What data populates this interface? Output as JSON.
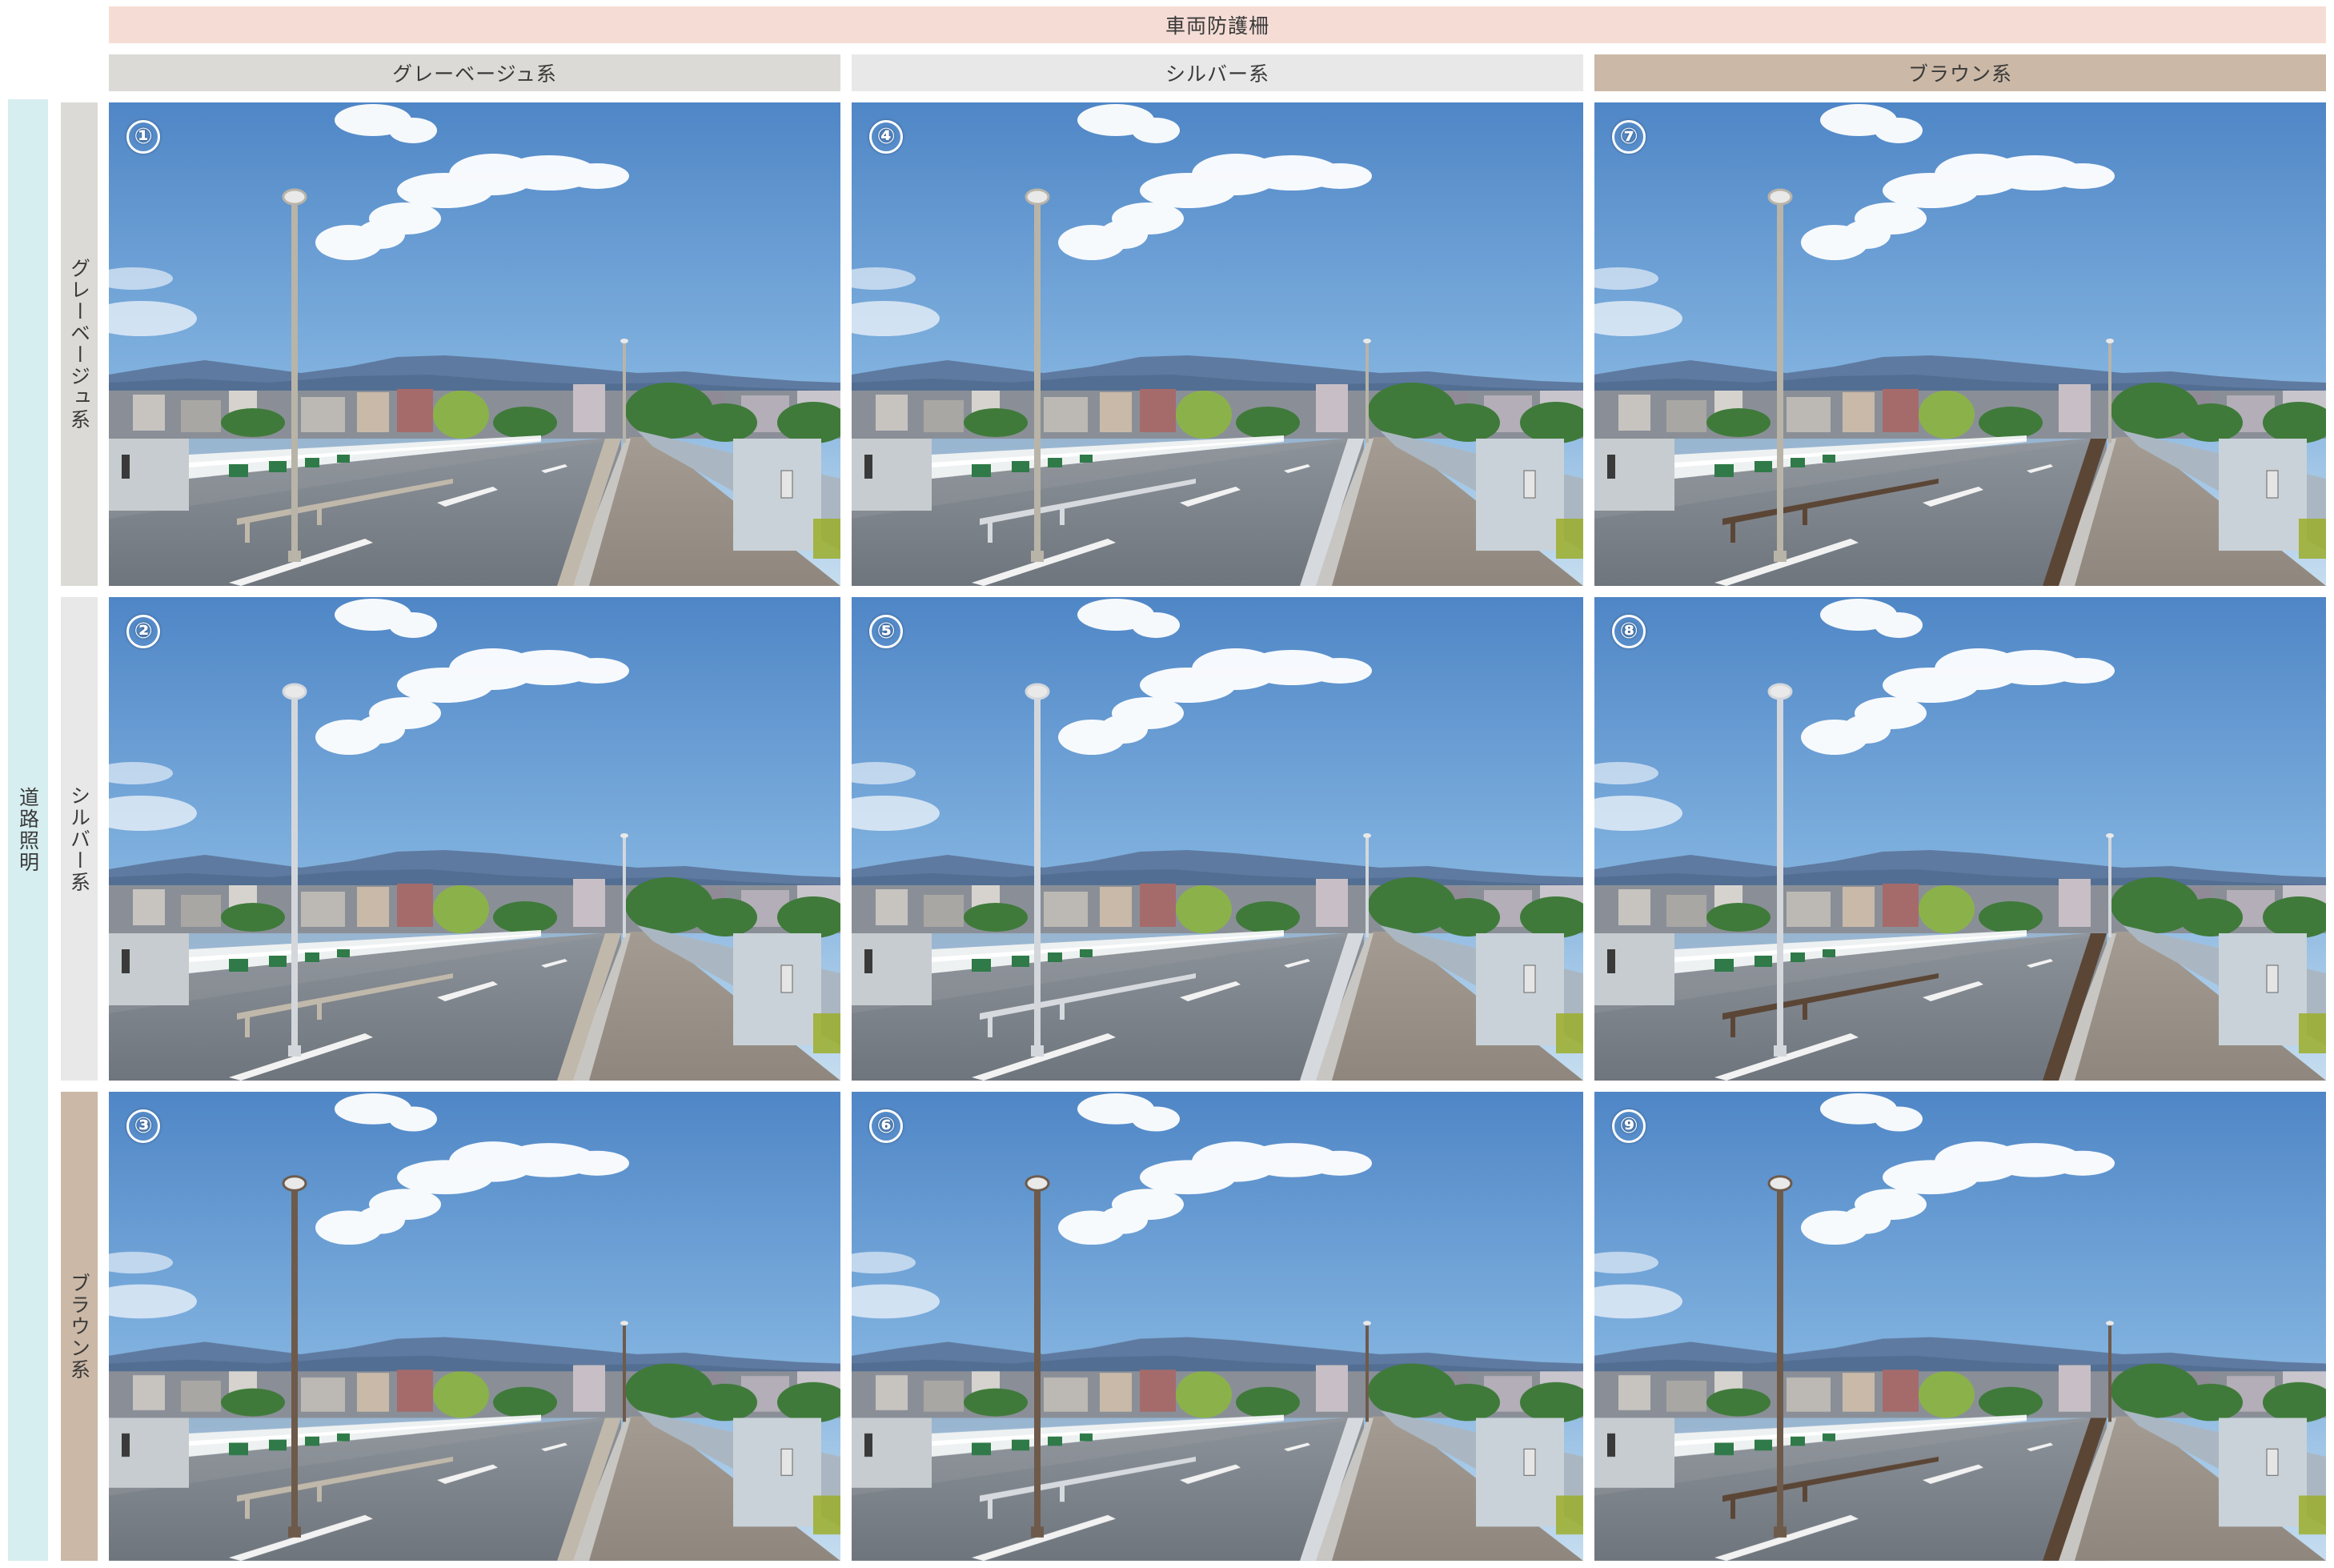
{
  "header": {
    "guardrail_title": "車両防護柵",
    "guardrail_colors": [
      "グレーベージュ系",
      "シルバー系",
      "ブラウン系"
    ]
  },
  "side": {
    "lighting_title": "道路照明",
    "lighting_colors": [
      "グレーベージュ系",
      "シルバー系",
      "ブラウン系"
    ]
  },
  "colors": {
    "top_banner": "#f5ddd6",
    "greige": "#dcdad6",
    "silver": "#e8e8e8",
    "brown": "#cbb8a6",
    "side_banner": "#d6eef0",
    "pole_greige": "#b9b4a8",
    "pole_silver": "#d3d7dc",
    "pole_brown": "#6e5a4a"
  },
  "grid": {
    "cells": [
      {
        "number": "①",
        "lighting": "greige",
        "guardrail": "greige"
      },
      {
        "number": "④",
        "lighting": "greige",
        "guardrail": "silver"
      },
      {
        "number": "⑦",
        "lighting": "greige",
        "guardrail": "brown"
      },
      {
        "number": "②",
        "lighting": "silver",
        "guardrail": "greige"
      },
      {
        "number": "⑤",
        "lighting": "silver",
        "guardrail": "silver"
      },
      {
        "number": "⑧",
        "lighting": "silver",
        "guardrail": "brown"
      },
      {
        "number": "③",
        "lighting": "brown",
        "guardrail": "greige"
      },
      {
        "number": "⑥",
        "lighting": "brown",
        "guardrail": "silver"
      },
      {
        "number": "⑨",
        "lighting": "brown",
        "guardrail": "brown"
      }
    ]
  }
}
